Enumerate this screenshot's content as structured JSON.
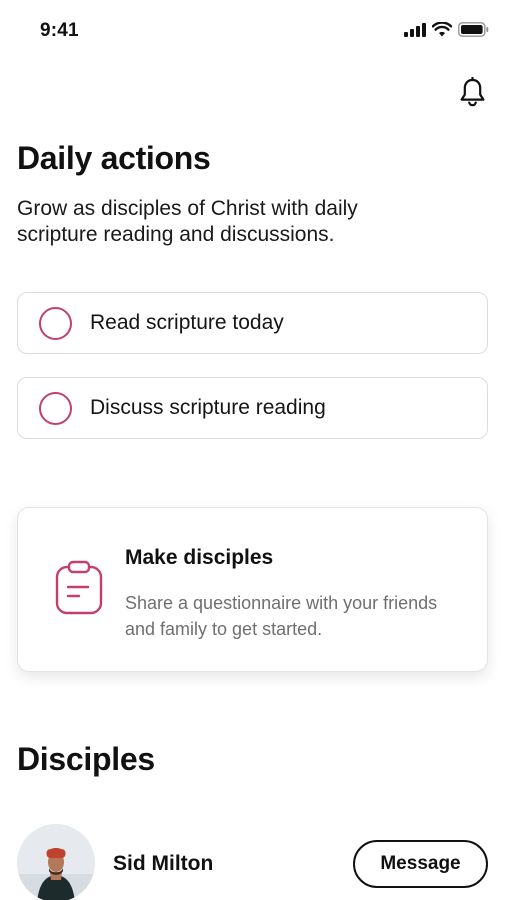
{
  "status_bar": {
    "time": "9:41",
    "icons": [
      "cellular-signal-icon",
      "wifi-icon",
      "battery-icon"
    ]
  },
  "header": {
    "notification_icon": "bell-icon"
  },
  "daily_actions": {
    "title": "Daily actions",
    "subtitle": "Grow as disciples of Christ with daily scripture reading and discussions.",
    "items": [
      {
        "label": "Read scripture today",
        "checked": false
      },
      {
        "label": "Discuss scripture reading",
        "checked": false
      }
    ]
  },
  "make_disciples": {
    "icon": "clipboard-icon",
    "title": "Make disciples",
    "description": "Share a questionnaire with your friends and family to get started."
  },
  "disciples": {
    "title": "Disciples",
    "list": [
      {
        "name": "Sid Milton",
        "action_label": "Message"
      }
    ]
  },
  "colors": {
    "accent": "#c2406b",
    "text": "#111111",
    "muted_text": "#6f6f6f",
    "card_border": "#dcdcdc"
  }
}
